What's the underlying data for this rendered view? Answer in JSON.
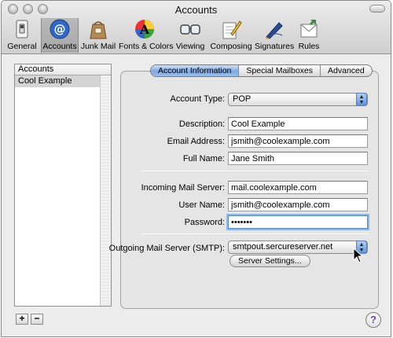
{
  "window": {
    "title": "Accounts"
  },
  "toolbar": [
    {
      "label": "General",
      "icon": "light-switch-icon"
    },
    {
      "label": "Accounts",
      "icon": "at-sign-icon"
    },
    {
      "label": "Junk Mail",
      "icon": "junk-mail-bag-icon"
    },
    {
      "label": "Fonts & Colors",
      "icon": "font-color-icon"
    },
    {
      "label": "Viewing",
      "icon": "glasses-icon"
    },
    {
      "label": "Composing",
      "icon": "pencil-paper-icon"
    },
    {
      "label": "Signatures",
      "icon": "fountain-pen-icon"
    },
    {
      "label": "Rules",
      "icon": "rules-icon"
    }
  ],
  "sidebar": {
    "header": "Accounts",
    "items": [
      "Cool Example"
    ]
  },
  "tabs": [
    "Account Information",
    "Special Mailboxes",
    "Advanced"
  ],
  "form": {
    "account_type_label": "Account Type:",
    "account_type_value": "POP",
    "description_label": "Description:",
    "description_value": "Cool Example",
    "email_label": "Email Address:",
    "email_value": "jsmith@coolexample.com",
    "fullname_label": "Full Name:",
    "fullname_value": "Jane Smith",
    "incoming_label": "Incoming Mail Server:",
    "incoming_value": "mail.coolexample.com",
    "username_label": "User Name:",
    "username_value": "jsmith@coolexample.com",
    "password_label": "Password:",
    "password_value": "•••••••",
    "outgoing_label": "Outgoing Mail Server (SMTP):",
    "outgoing_value": "smtpout.sercureserver.net",
    "server_settings_label": "Server Settings..."
  },
  "bottom": {
    "add": "+",
    "remove": "−",
    "help": "?"
  },
  "colors": {
    "selected_tab": "#7ca7e0",
    "list_selection": "#d4d4d4",
    "focus_ring": "#8fb6e8"
  }
}
